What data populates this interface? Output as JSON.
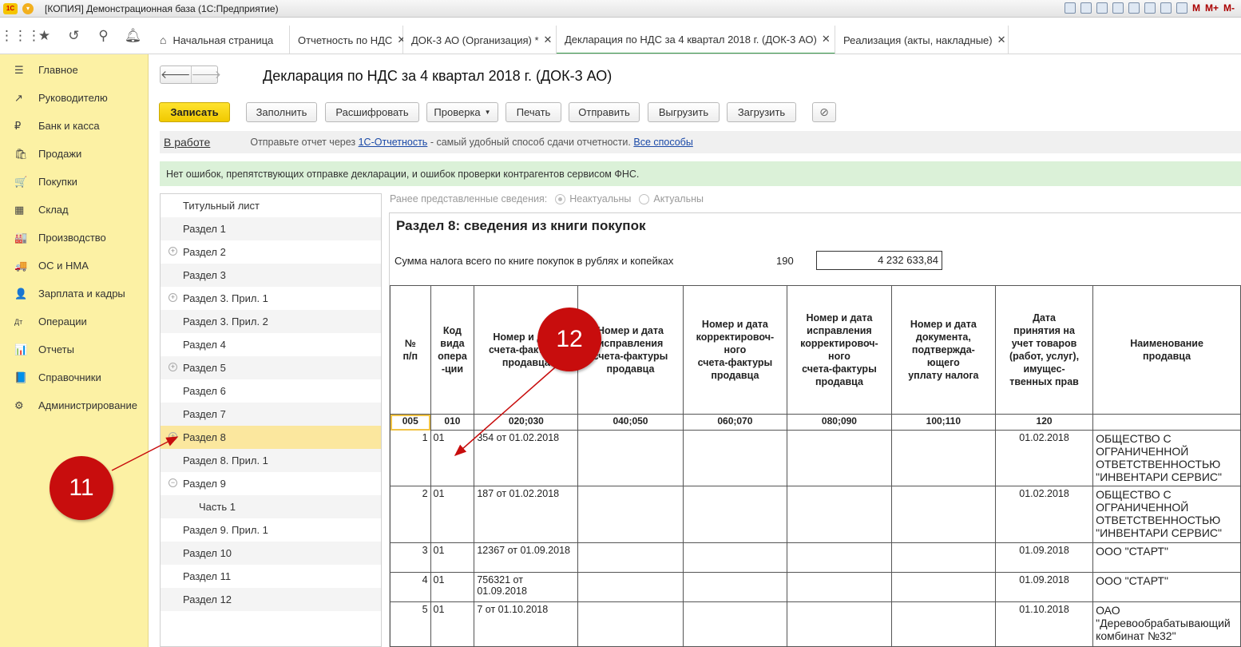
{
  "window": {
    "title": "[КОПИЯ] Демонстрационная база  (1С:Предприятие)",
    "logo": "1С",
    "right_labels": [
      "M",
      "M+",
      "M-"
    ]
  },
  "tabs": [
    {
      "label": "Начальная страница",
      "icon": "home-icon"
    },
    {
      "label": "Отчетность по НДС"
    },
    {
      "label": "ДОК-3 АО (Организация) *"
    },
    {
      "label": "Декларация по НДС за 4 квартал 2018 г. (ДОК-3 АО)"
    },
    {
      "label": "Реализация (акты, накладные)"
    }
  ],
  "sidebar": {
    "items": [
      {
        "label": "Главное",
        "icon": "☰"
      },
      {
        "label": "Руководителю",
        "icon": "↗"
      },
      {
        "label": "Банк и касса",
        "icon": "₽"
      },
      {
        "label": "Продажи",
        "icon": "🛍"
      },
      {
        "label": "Покупки",
        "icon": "🛒"
      },
      {
        "label": "Склад",
        "icon": "▦"
      },
      {
        "label": "Производство",
        "icon": "🏭"
      },
      {
        "label": "ОС и НМА",
        "icon": "🚚"
      },
      {
        "label": "Зарплата и кадры",
        "icon": "👤"
      },
      {
        "label": "Операции",
        "icon": "Дт"
      },
      {
        "label": "Отчеты",
        "icon": "📊"
      },
      {
        "label": "Справочники",
        "icon": "📘"
      },
      {
        "label": "Администрирование",
        "icon": "⚙"
      }
    ]
  },
  "document": {
    "title": "Декларация по НДС за 4 квартал 2018 г. (ДОК-3 АО)"
  },
  "toolbar": {
    "save": "Записать",
    "fill": "Заполнить",
    "decode": "Расшифровать",
    "check": "Проверка",
    "print": "Печать",
    "send": "Отправить",
    "export": "Выгрузить",
    "import": "Загрузить"
  },
  "status": {
    "state": "В работе",
    "info_prefix": "Отправьте отчет через",
    "info_link": "1С-Отчетность",
    "info_suffix": "- самый удобный способ сдачи отчетности.",
    "all_ways": "Все способы"
  },
  "ok_message": "Нет ошибок, препятствующих отправке декларации, и ошибок проверки контрагентов сервисом ФНС.",
  "previous": {
    "label": "Ранее представленные сведения:",
    "option1": "Неактуальны",
    "option2": "Актуальны"
  },
  "sections": [
    {
      "label": "Титульный лист"
    },
    {
      "label": "Раздел 1"
    },
    {
      "label": "Раздел 2",
      "expand": "+"
    },
    {
      "label": "Раздел 3"
    },
    {
      "label": "Раздел 3. Прил. 1",
      "expand": "+"
    },
    {
      "label": "Раздел 3. Прил. 2"
    },
    {
      "label": "Раздел 4"
    },
    {
      "label": "Раздел 5",
      "expand": "+"
    },
    {
      "label": "Раздел 6"
    },
    {
      "label": "Раздел 7"
    },
    {
      "label": "Раздел 8",
      "expand": "+"
    },
    {
      "label": "Раздел 8. Прил. 1"
    },
    {
      "label": "Раздел 9",
      "expand": "−"
    },
    {
      "label": "Часть 1"
    },
    {
      "label": "Раздел 9. Прил. 1"
    },
    {
      "label": "Раздел 10"
    },
    {
      "label": "Раздел 11"
    },
    {
      "label": "Раздел 12"
    }
  ],
  "form": {
    "title": "Раздел 8: сведения из книги покупок",
    "sum_label": "Сумма налога всего по книге покупок в рублях и копейках",
    "sum_code": "190",
    "sum_value": "4 232 633,84",
    "headers": [
      "№\nп/п",
      "Код\nвида\nопера\n-ции",
      "Номер и дата\nсчета-фактуры\nпродавца",
      "Номер и дата\nисправления\nсчета-фактуры\nпродавца",
      "Номер и дата\nкорректировоч-\nного\nсчета-фактуры\nпродавца",
      "Номер и дата\nисправления\nкорректировоч-\nного\nсчета-фактуры\nпродавца",
      "Номер и дата\nдокумента,\nподтвержда-\nющего\nуплату налога",
      "Дата\nпринятия на\nучет  товаров\n(работ, услуг),\nимущес-\nтвенных прав",
      "Наименование\nпродавца"
    ],
    "codes": [
      "005",
      "010",
      "020;030",
      "040;050",
      "060;070",
      "080;090",
      "100;110",
      "120",
      ""
    ],
    "rows": [
      {
        "n": "1",
        "op": "01",
        "invoice": "354 от 01.02.2018",
        "date": "01.02.2018",
        "seller": "ОБЩЕСТВО С ОГРАНИЧЕННОЙ ОТВЕТСТВЕННОСТЬЮ \"ИНВЕНТАРИ СЕРВИС\""
      },
      {
        "n": "2",
        "op": "01",
        "invoice": "187 от 01.02.2018",
        "date": "01.02.2018",
        "seller": "ОБЩЕСТВО С ОГРАНИЧЕННОЙ ОТВЕТСТВЕННОСТЬЮ \"ИНВЕНТАРИ СЕРВИС\""
      },
      {
        "n": "3",
        "op": "01",
        "invoice": "12367 от 01.09.2018",
        "date": "01.09.2018",
        "seller": "ООО \"СТАРТ\""
      },
      {
        "n": "4",
        "op": "01",
        "invoice": "756321 от 01.09.2018",
        "date": "01.09.2018",
        "seller": "ООО \"СТАРТ\""
      },
      {
        "n": "5",
        "op": "01",
        "invoice": "7 от 01.10.2018",
        "date": "01.10.2018",
        "seller": "ОАО \"Деревообрабатывающий комбинат №32\""
      }
    ]
  },
  "annotations": {
    "badge11": "11",
    "badge12": "12",
    "color": "#c80d0d"
  }
}
